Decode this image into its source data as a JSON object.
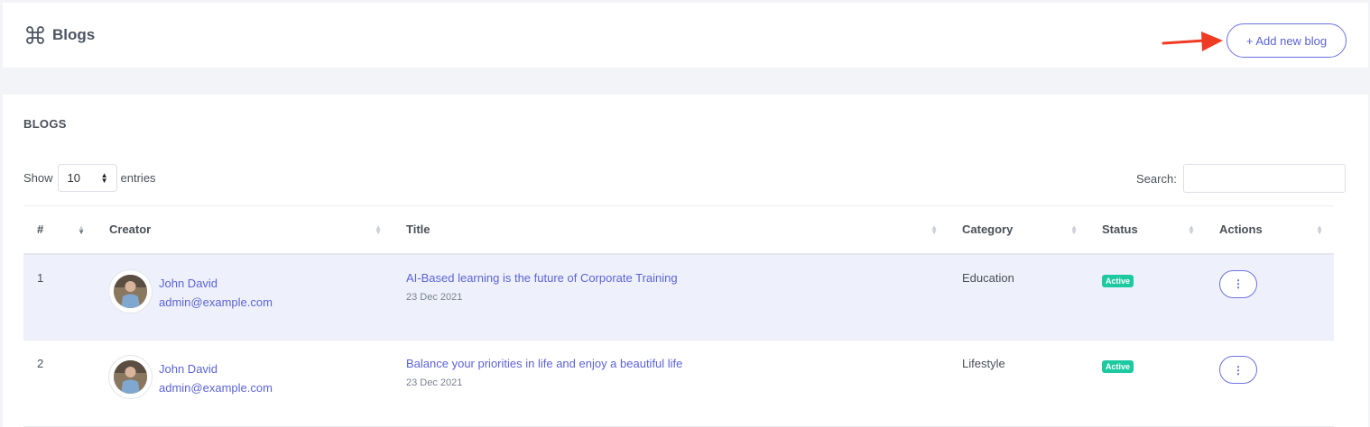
{
  "header": {
    "title": "Blogs",
    "add_button_label": "+ Add new blog"
  },
  "card": {
    "title": "BLOGS",
    "show_label": "Show",
    "entries_value": "10",
    "entries_label": "entries",
    "search_label": "Search:",
    "search_value": ""
  },
  "table": {
    "columns": [
      "#",
      "Creator",
      "Title",
      "Category",
      "Status",
      "Actions"
    ],
    "rows": [
      {
        "num": "1",
        "creator_name": "John David",
        "creator_email": "admin@example.com",
        "title": "AI-Based learning is the future of Corporate Training",
        "date": "23 Dec 2021",
        "category": "Education",
        "status": "Active",
        "action_label": "⋮"
      },
      {
        "num": "2",
        "creator_name": "John David",
        "creator_email": "admin@example.com",
        "title": "Balance your priorities in life and enjoy a beautiful life",
        "date": "23 Dec 2021",
        "category": "Lifestyle",
        "status": "Active",
        "action_label": "⋮"
      }
    ]
  },
  "colors": {
    "accent": "#5c63d6",
    "active_badge": "#1dc9a0",
    "arrow": "#ef3b24",
    "row_highlight": "#eef1fb"
  },
  "icons": {
    "title_icon": "command-icon",
    "annotation": "red-arrow-icon"
  }
}
